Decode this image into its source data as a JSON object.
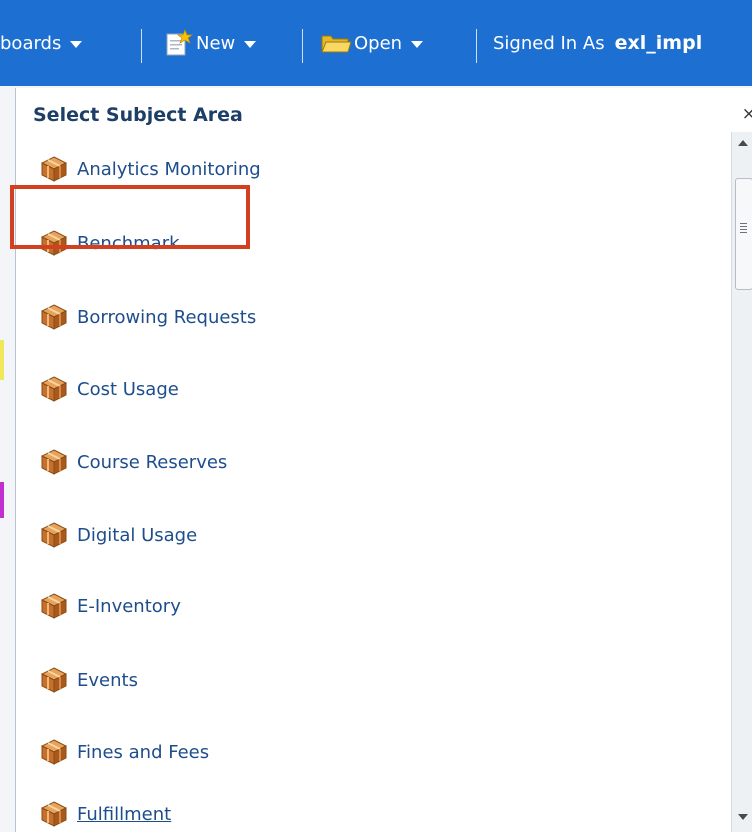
{
  "toolbar": {
    "dashboards_label": "boards",
    "new_label": "New",
    "open_label": "Open",
    "signed_in_label": "Signed In As",
    "username": "exl_impl"
  },
  "panel": {
    "title": "Select Subject Area",
    "close_label": "×",
    "items": [
      {
        "label": "Analytics Monitoring"
      },
      {
        "label": "Benchmark",
        "highlighted": true
      },
      {
        "label": "Borrowing Requests"
      },
      {
        "label": "Cost Usage"
      },
      {
        "label": "Course Reserves"
      },
      {
        "label": "Digital Usage"
      },
      {
        "label": "E-Inventory"
      },
      {
        "label": "Events"
      },
      {
        "label": "Fines and Fees"
      },
      {
        "label": "Fulfillment",
        "hovered": true
      }
    ]
  },
  "colors": {
    "toolbar_bg": "#1d6fd1",
    "title": "#1d3e66",
    "link": "#1e4d8c",
    "highlight_border": "#d2401f"
  },
  "icons": {
    "new": "new-document-icon",
    "open": "folder-icon",
    "subject_area": "cube-icon"
  }
}
